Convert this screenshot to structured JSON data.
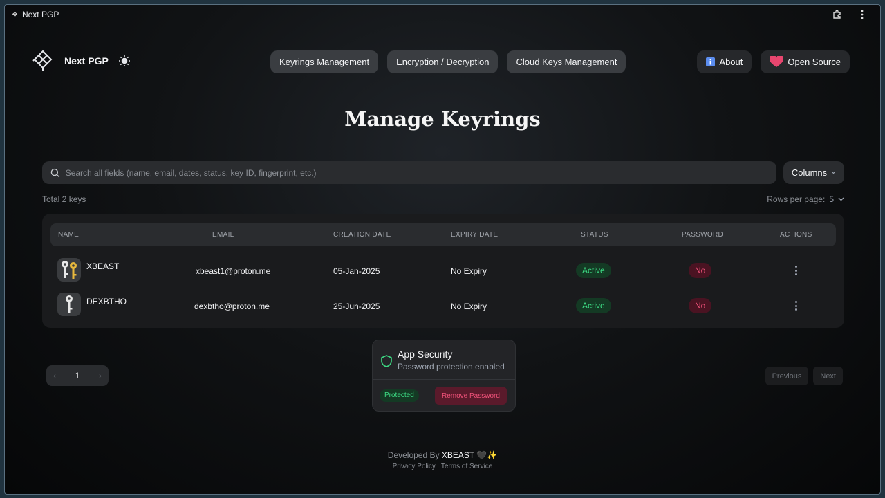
{
  "window": {
    "title": "Next PGP"
  },
  "brand": {
    "name": "Next PGP"
  },
  "nav": {
    "center": [
      "Keyrings Management",
      "Encryption / Decryption",
      "Cloud Keys Management"
    ],
    "about": "About",
    "open_source": "Open Source"
  },
  "page": {
    "title": "Manage Keyrings"
  },
  "search": {
    "placeholder": "Search all fields (name, email, dates, status, key ID, fingerprint, etc.)"
  },
  "columns_button": "Columns",
  "total": "Total 2 keys",
  "rows_per_page": {
    "label": "Rows per page:",
    "value": "5"
  },
  "table": {
    "headers": [
      "NAME",
      "EMAIL",
      "CREATION DATE",
      "EXPIRY DATE",
      "STATUS",
      "PASSWORD",
      "ACTIONS"
    ],
    "rows": [
      {
        "name": "XBEAST",
        "email": "xbeast1@proton.me",
        "created": "05-Jan-2025",
        "expiry": "No Expiry",
        "status": "Active",
        "password": "No",
        "avatar": "key-pair-icon"
      },
      {
        "name": "DEXBTHO",
        "email": "dexbtho@proton.me",
        "created": "25-Jun-2025",
        "expiry": "No Expiry",
        "status": "Active",
        "password": "No",
        "avatar": "key-icon"
      }
    ]
  },
  "pagination": {
    "page": "1",
    "previous": "Previous",
    "next": "Next"
  },
  "security": {
    "title": "App Security",
    "subtitle": "Password protection enabled",
    "badge": "Protected",
    "remove": "Remove Password"
  },
  "footer": {
    "developed_by": "Developed By",
    "developer": "XBEAST",
    "emoji": "🖤✨",
    "privacy": "Privacy Policy",
    "terms": "Terms of Service"
  },
  "colors": {
    "active": "#3ddc84",
    "danger": "#f0527a",
    "heart": "#e8466f"
  }
}
